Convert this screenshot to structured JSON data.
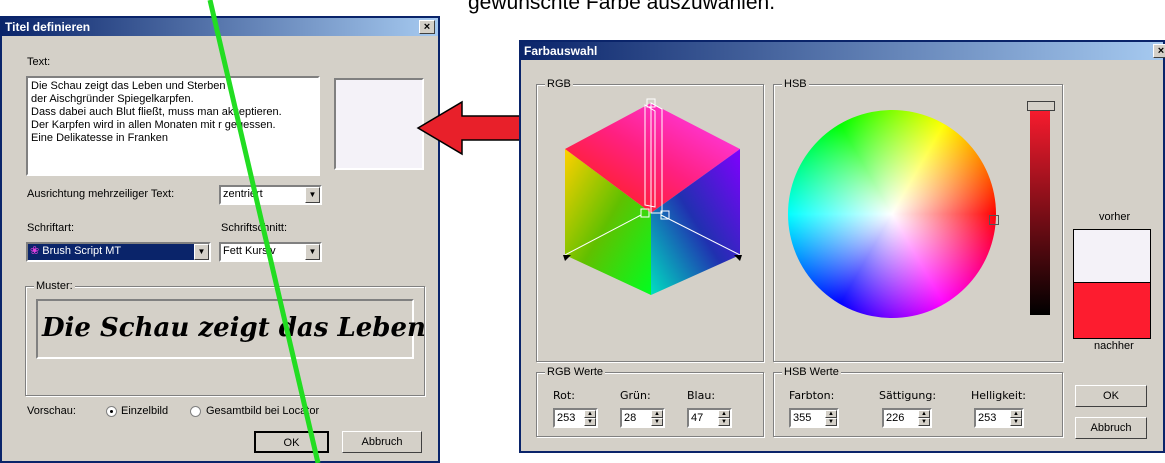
{
  "instruction_text": "gewünschte Farbe auszuwählen.",
  "left_dialog": {
    "title": "Titel definieren",
    "close_label": "×",
    "text_label": "Text:",
    "text_lines": [
      "Die Schau zeigt das Leben  und Sterben",
      "der Aischgründer Spiegelkarpfen.",
      "Dass dabei auch Blut fließt, muss man akzeptieren.",
      "Der Karpfen wird in allen Monaten mit r gegessen.",
      "Eine Delikatesse in Franken"
    ],
    "alignment_label": "Ausrichtung mehrzeiliger Text:",
    "alignment_value": "zentriert",
    "font_label": "Schriftart:",
    "font_value": "Brush Script MT",
    "style_label": "Schriftschnitt:",
    "style_value": "Fett Kursiv",
    "sample_label": "Muster:",
    "sample_text": "Die Schau zeigt das Leben",
    "preview_label": "Vorschau:",
    "preview_options": [
      "Einzelbild",
      "Gesamtbild bei Locator"
    ],
    "preview_selected": "Einzelbild",
    "ok_label": "OK",
    "cancel_label": "Abbruch",
    "swatch_color": "#f4f2f8"
  },
  "color_dialog": {
    "title": "Farbauswahl",
    "close_label": "×",
    "rgb_group": "RGB",
    "hsb_group": "HSB",
    "before_label": "vorher",
    "after_label": "nachher",
    "before_color": "#f4f2f8",
    "after_color": "#fd1c2f",
    "rgb_values_group": "RGB Werte",
    "hsb_values_group": "HSB Werte",
    "fields": {
      "red_label": "Rot:",
      "red": "253",
      "green_label": "Grün:",
      "green": "28",
      "blue_label": "Blau:",
      "blue": "47",
      "hue_label": "Farbton:",
      "hue": "355",
      "sat_label": "Sättigung:",
      "sat": "226",
      "bright_label": "Helligkeit:",
      "bright": "253"
    },
    "ok_label": "OK",
    "cancel_label": "Abbruch"
  },
  "arrow_color": "#e8202a",
  "line_color": "#22dd22"
}
